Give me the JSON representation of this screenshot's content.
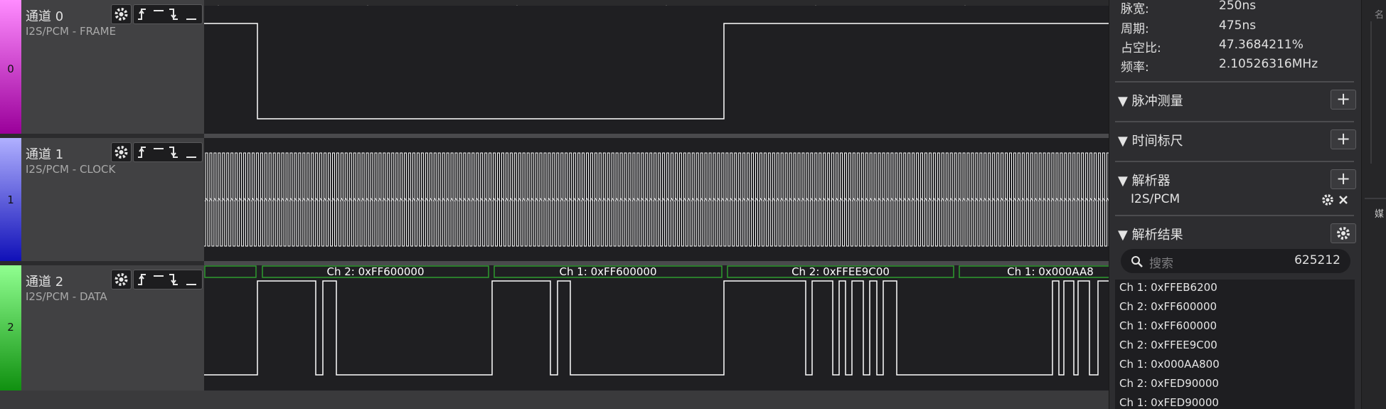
{
  "channels": [
    {
      "index": "0",
      "name": "通道 0",
      "protocol": "I2S/PCM - FRAME",
      "color_top": "#ff8cff",
      "color_bottom": "#9a009a"
    },
    {
      "index": "1",
      "name": "通道 1",
      "protocol": "I2S/PCM - CLOCK",
      "color_top": "#b0b0ff",
      "color_bottom": "#1010b8"
    },
    {
      "index": "2",
      "name": "通道 2",
      "protocol": "I2S/PCM - DATA",
      "color_top": "#90ff90",
      "color_bottom": "#109010"
    }
  ],
  "decode_labels": [
    "Ch 2: 0xFF600000",
    "Ch 1: 0xFF600000",
    "Ch 2: 0xFFEE9C00",
    "Ch 1: 0x000AA8"
  ],
  "measurements": {
    "pulse_width": {
      "label": "脉宽:",
      "value": "250ns"
    },
    "period": {
      "label": "周期:",
      "value": "475ns"
    },
    "duty": {
      "label": "占空比:",
      "value": "47.3684211%"
    },
    "frequency": {
      "label": "频率:",
      "value": "2.10526316MHz"
    }
  },
  "sections": {
    "pulse_measure": "▼ 脉冲测量",
    "time_ruler": "▼ 时间标尺",
    "analyzer": "▼ 解析器",
    "analyzer_item": "I2S/PCM",
    "results": "▼ 解析结果"
  },
  "search": {
    "placeholder": "搜索",
    "count": "625212"
  },
  "results": [
    "Ch 1: 0xFFEB6200",
    "Ch 2: 0xFF600000",
    "Ch 1: 0xFF600000",
    "Ch 2: 0xFFEE9C00",
    "Ch 1: 0x000AA800",
    "Ch 2: 0xFED90000",
    "Ch 1: 0xFED90000"
  ],
  "right_edge_glyphs": {
    "a": "名",
    "b": "媒"
  },
  "colors": {
    "wave": "#ffffff",
    "decode_box": "#2e9c2e"
  }
}
